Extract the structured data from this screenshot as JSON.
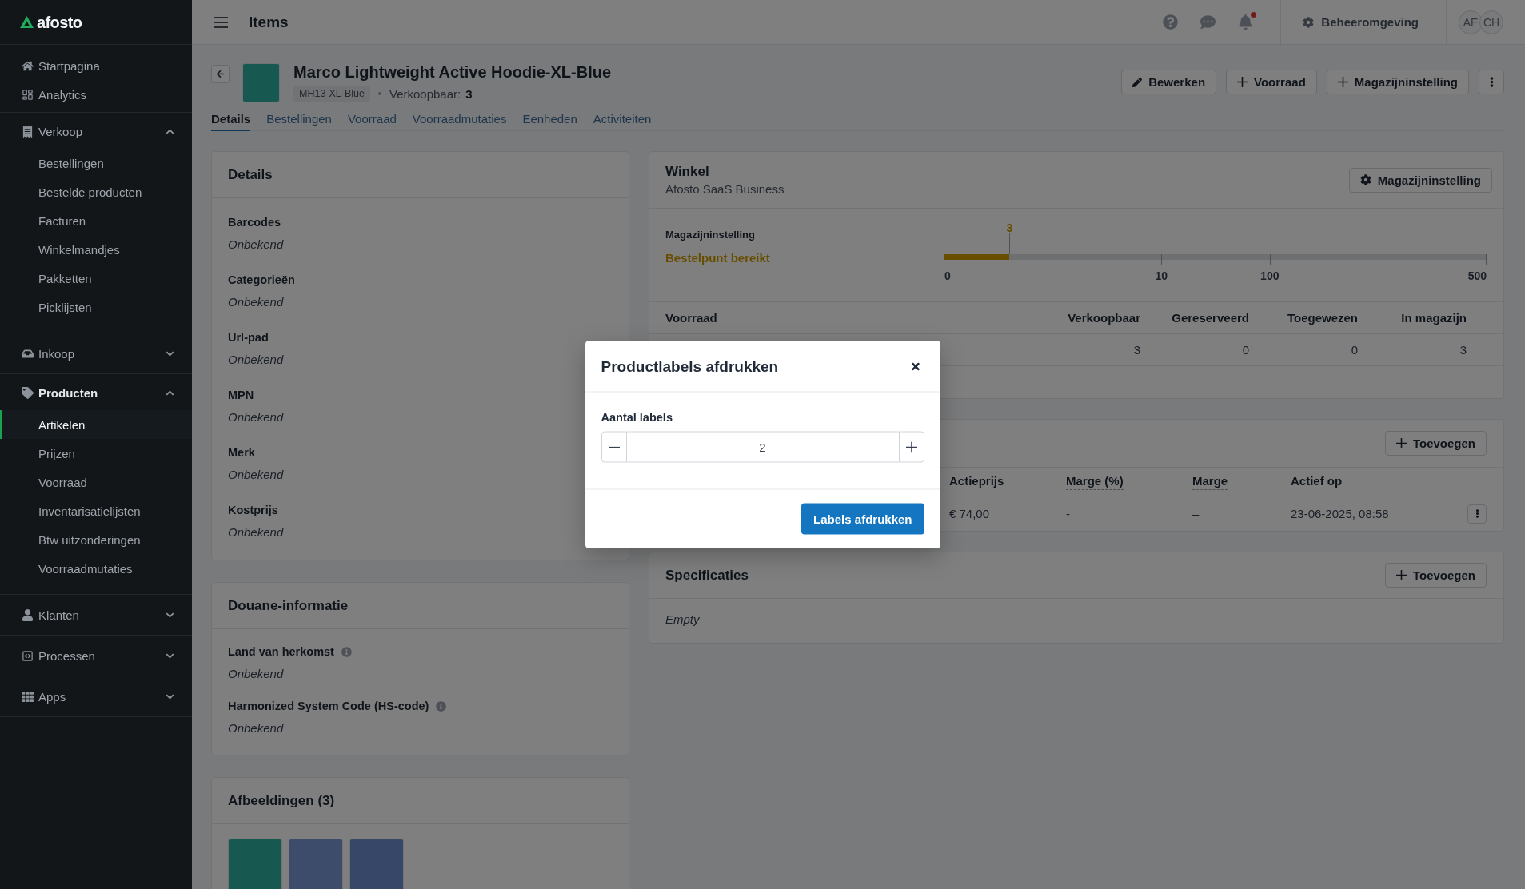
{
  "sidebar": {
    "logo": "afosto",
    "sections": [
      {
        "kind": "links",
        "items": [
          {
            "label": "Startpagina",
            "selected": false
          },
          {
            "label": "Analytics",
            "selected": false
          }
        ]
      },
      {
        "kind": "group",
        "label": "Verkoop",
        "selected": false,
        "expanded": true,
        "children": [
          {
            "label": "Bestellingen",
            "selected": false
          },
          {
            "label": "Bestelde producten",
            "selected": false
          },
          {
            "label": "Facturen",
            "selected": false
          },
          {
            "label": "Winkelmandjes",
            "selected": false
          },
          {
            "label": "Pakketten",
            "selected": false
          },
          {
            "label": "Picklijsten",
            "selected": false
          }
        ]
      },
      {
        "kind": "group",
        "label": "Inkoop",
        "selected": false,
        "expanded": false
      },
      {
        "kind": "group",
        "label": "Producten",
        "selected": true,
        "expanded": true,
        "children": [
          {
            "label": "Artikelen",
            "selected": true
          },
          {
            "label": "Prijzen",
            "selected": false
          },
          {
            "label": "Voorraad",
            "selected": false
          },
          {
            "label": "Inventarisatielijsten",
            "selected": false
          },
          {
            "label": "Btw uitzonderingen",
            "selected": false
          },
          {
            "label": "Voorraadmutaties",
            "selected": false
          }
        ]
      },
      {
        "kind": "group",
        "label": "Klanten",
        "selected": false,
        "expanded": false
      },
      {
        "kind": "group",
        "label": "Processen",
        "selected": false,
        "expanded": false
      },
      {
        "kind": "group",
        "label": "Apps",
        "selected": false,
        "expanded": false
      }
    ]
  },
  "header": {
    "title": "Items",
    "unread_notifications": true,
    "environment": "Beheeromgeving",
    "avatars": [
      {
        "initials": "AE"
      },
      {
        "initials": "CH"
      }
    ]
  },
  "product": {
    "title": "Marco Lightweight Active Hoodie-XL-Blue",
    "sku": "MH13-XL-Blue",
    "meta_label": "Verkoopbaar:",
    "meta_value": "3",
    "actions": [
      {
        "kind": "edit",
        "label": "Bewerken"
      },
      {
        "kind": "add",
        "label": "Voorraad"
      },
      {
        "kind": "add",
        "label": "Magazijninstelling"
      }
    ]
  },
  "tabs": [
    {
      "label": "Details",
      "selected": true
    },
    {
      "label": "Bestellingen",
      "selected": false
    },
    {
      "label": "Voorraad",
      "selected": false
    },
    {
      "label": "Voorraadmutaties",
      "selected": false
    },
    {
      "label": "Eenheden",
      "selected": false
    },
    {
      "label": "Activiteiten",
      "selected": false
    }
  ],
  "details_card": {
    "title": "Details",
    "fields": [
      {
        "label": "Barcodes",
        "value": "Onbekend"
      },
      {
        "label": "Categorieën",
        "value": "Onbekend"
      },
      {
        "label": "Url-pad",
        "value": "Onbekend"
      },
      {
        "label": "MPN",
        "value": "Onbekend"
      },
      {
        "label": "Merk",
        "value": "Onbekend"
      },
      {
        "label": "Kostprijs",
        "value": "Onbekend"
      }
    ]
  },
  "customs_card": {
    "title": "Douane-informatie",
    "fields": [
      {
        "label": "Land van herkomst",
        "value": "Onbekend",
        "info": true
      },
      {
        "label": "Harmonized System Code (HS-code)",
        "value": "Onbekend",
        "info": true
      }
    ]
  },
  "images_card": {
    "title": "Afbeeldingen (3)",
    "images": [
      {
        "kind": "front"
      },
      {
        "kind": "closeup"
      },
      {
        "kind": "back"
      }
    ]
  },
  "warehouse_card": {
    "title": "Winkel",
    "subtitle": "Afosto SaaS Business",
    "button": "Magazijninstelling",
    "setting": {
      "label": "Magazijninstelling",
      "status": "Bestelpunt bereikt",
      "marker": "3",
      "level": 0.12,
      "ticks": [
        {
          "label": "0",
          "has_tooltip": false
        },
        {
          "label": "10",
          "has_tooltip": true
        },
        {
          "label": "100",
          "has_tooltip": true
        },
        {
          "label": "500",
          "has_tooltip": true
        }
      ]
    },
    "stock_table": {
      "columns": [
        "Voorraad",
        "Verkoopbaar",
        "Gereserveerd",
        "Toegewezen",
        "In magazijn"
      ],
      "rows": [
        {
          "values": [
            "3",
            "0",
            "0",
            "3"
          ]
        }
      ]
    }
  },
  "prices_card": {
    "button": "Toevoegen",
    "columns": [
      {
        "label": "Actieprijs",
        "has_tooltip": false
      },
      {
        "label": "Marge (%)",
        "has_tooltip": true
      },
      {
        "label": "Marge",
        "has_tooltip": true
      },
      {
        "label": "Actief op",
        "has_tooltip": false
      }
    ],
    "rows": [
      {
        "cells": [
          "€ 74,00",
          "-",
          "–",
          "23-06-2025, 08:58"
        ]
      }
    ]
  },
  "specs_card": {
    "title": "Specificaties",
    "button": "Toevoegen",
    "empty": "Empty"
  },
  "modal": {
    "title": "Productlabels afdrukken",
    "field_label": "Aantal labels",
    "value": "2",
    "submit": "Labels afdrukken"
  }
}
